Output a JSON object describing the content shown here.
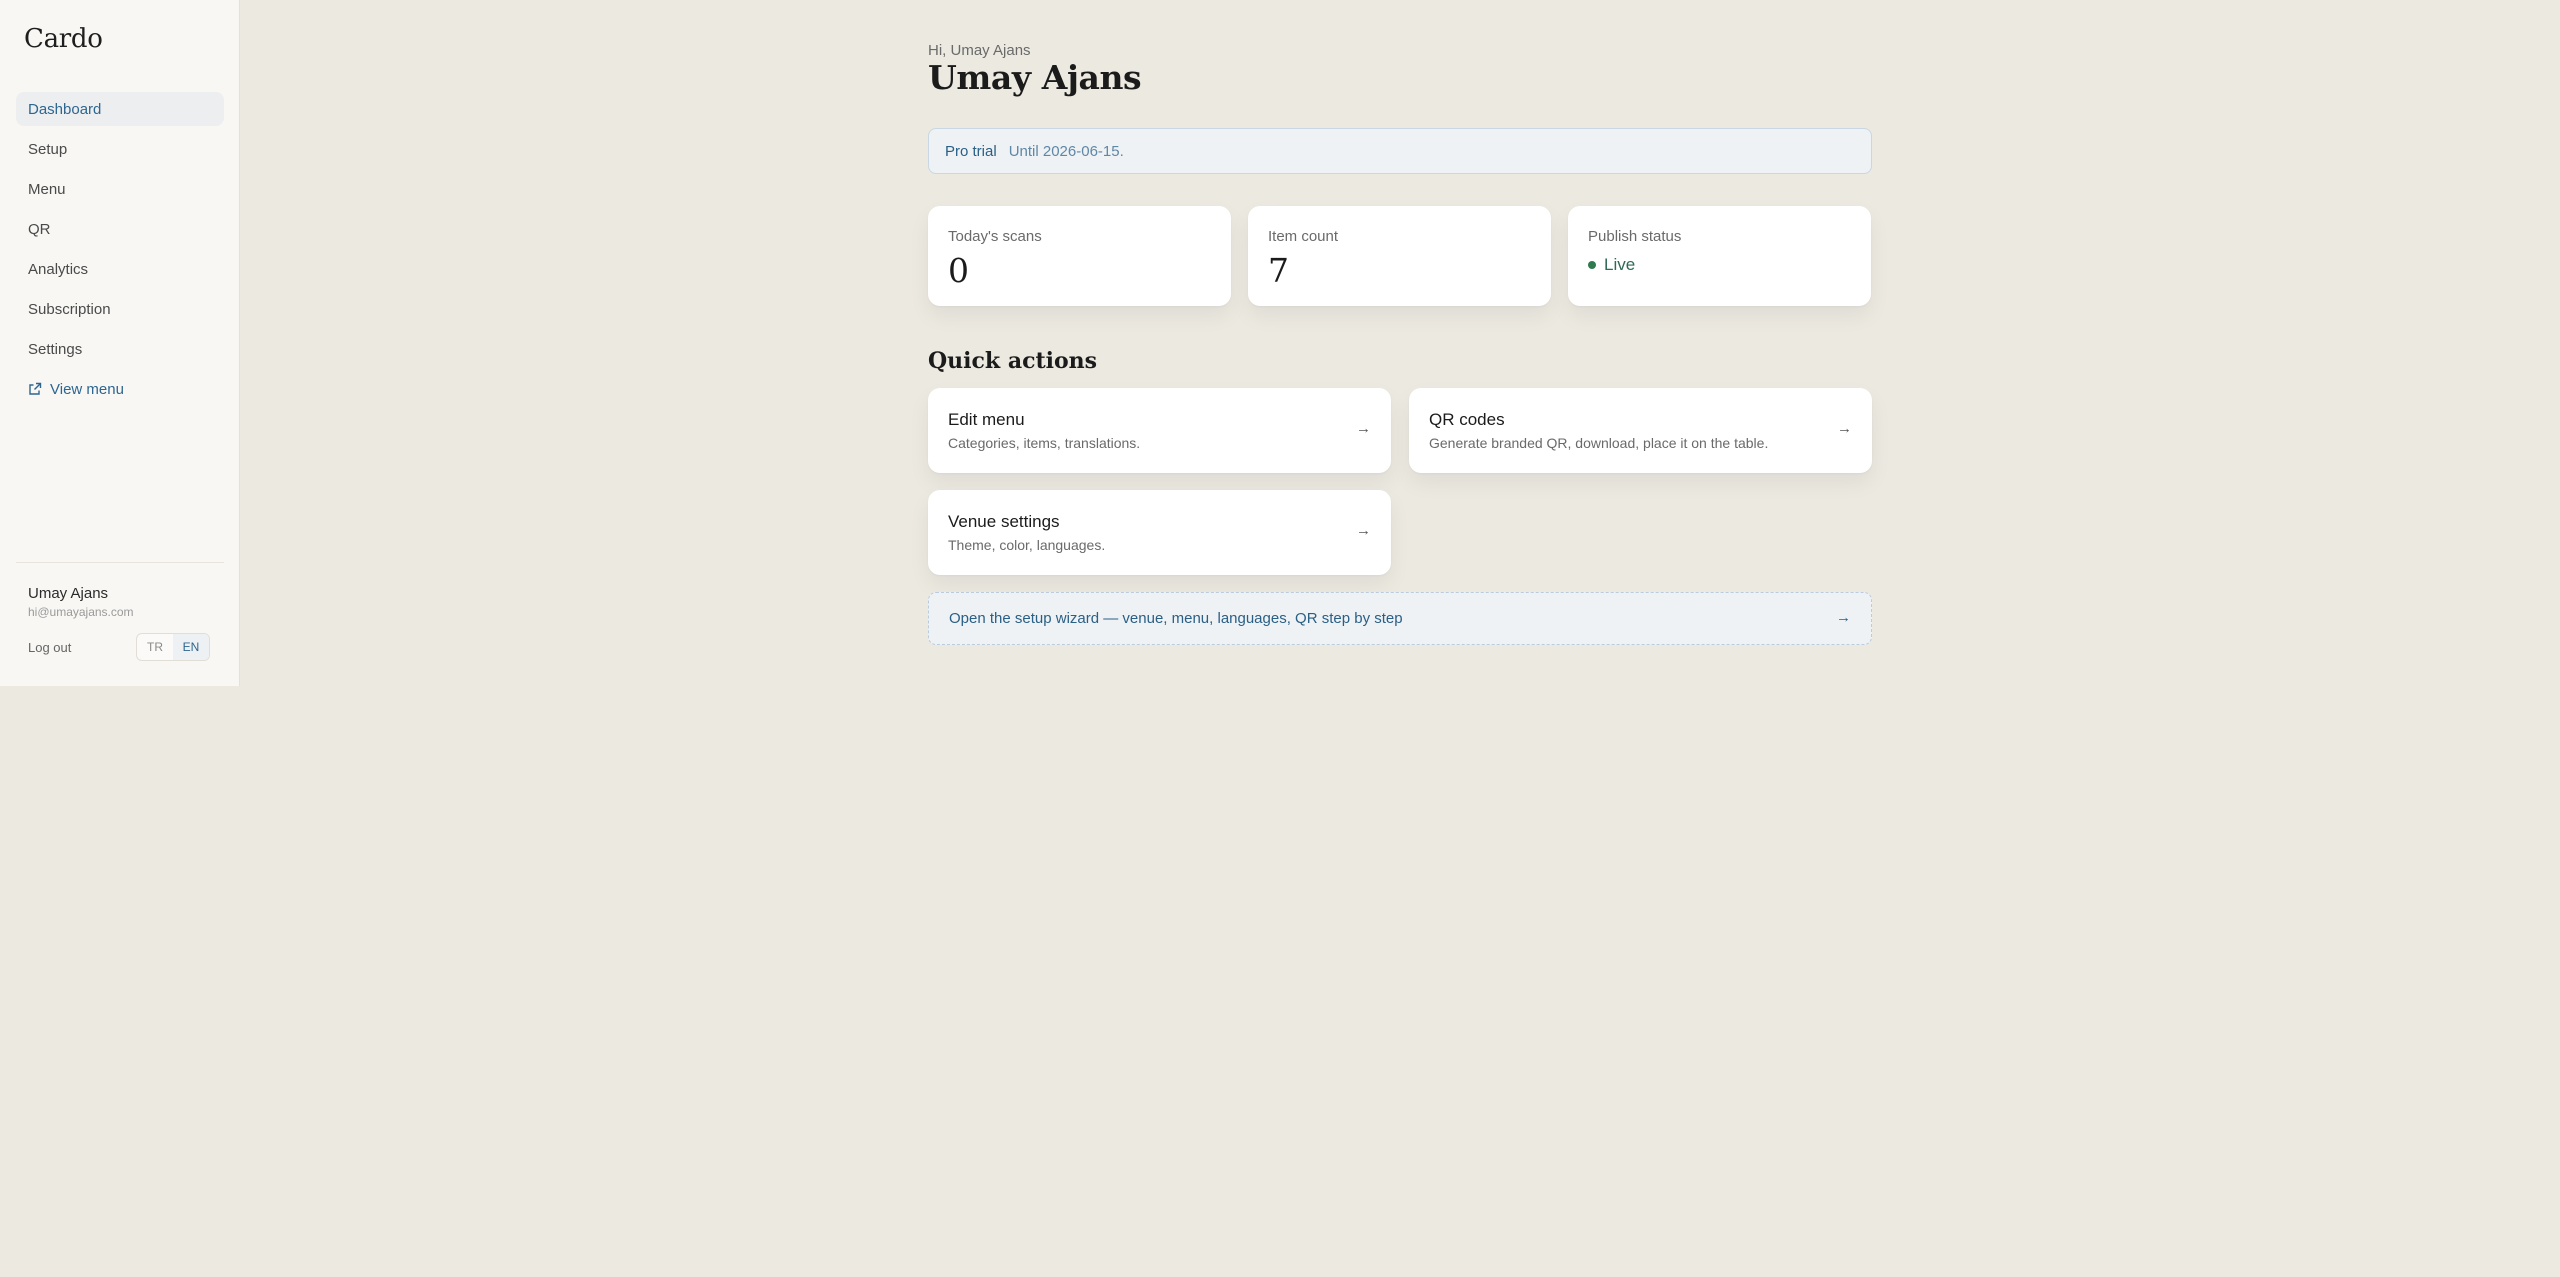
{
  "app": {
    "brand": "Cardo"
  },
  "sidebar": {
    "items": [
      {
        "label": "Dashboard",
        "active": true
      },
      {
        "label": "Setup"
      },
      {
        "label": "Menu"
      },
      {
        "label": "QR"
      },
      {
        "label": "Analytics"
      },
      {
        "label": "Subscription"
      },
      {
        "label": "Settings"
      }
    ],
    "view_menu": {
      "label": "View menu",
      "icon": "external-link-icon"
    },
    "user": {
      "name": "Umay Ajans",
      "email": "hi@umayajans.com"
    },
    "logout_label": "Log out",
    "languages": [
      "TR",
      "EN"
    ],
    "active_language": "EN"
  },
  "main": {
    "greeting": "Hi, Umay Ajans",
    "title": "Umay Ajans",
    "trial": {
      "label": "Pro trial",
      "until": "Until 2026-06-15."
    },
    "stats": {
      "scans": {
        "label": "Today's scans",
        "value": "0"
      },
      "items": {
        "label": "Item count",
        "value": "7"
      },
      "publish": {
        "label": "Publish status",
        "value": "Live"
      }
    },
    "quick_actions_title": "Quick actions",
    "actions": {
      "edit_menu": {
        "title": "Edit menu",
        "desc": "Categories, items, translations.",
        "arrow": "→"
      },
      "qr_codes": {
        "title": "QR codes",
        "desc": "Generate branded QR, download, place it on the table.",
        "arrow": "→"
      },
      "venue": {
        "title": "Venue settings",
        "desc": "Theme, color, languages.",
        "arrow": "→"
      }
    },
    "wizard": {
      "label": "Open the setup wizard — venue, menu, languages, QR step by step",
      "arrow": "→"
    }
  },
  "colors": {
    "background": "#ece9e1",
    "accent": "#2d6690",
    "live": "#2f7a4f"
  }
}
